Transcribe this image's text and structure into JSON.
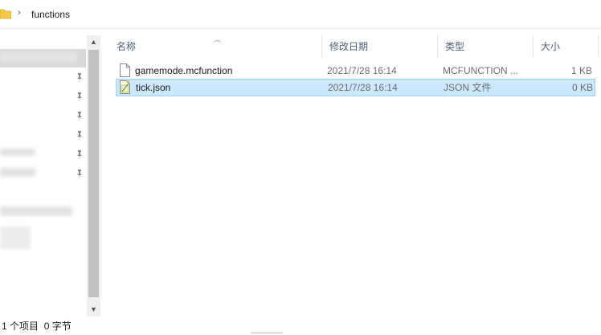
{
  "address_bar": {
    "folder_icon": "folder-icon",
    "separator": "›",
    "crumbs": [
      "functions"
    ]
  },
  "columns": {
    "name": "名称",
    "date": "修改日期",
    "type": "类型",
    "size": "大小"
  },
  "files": [
    {
      "name": "gamemode.mcfunction",
      "date": "2021/7/28 16:14",
      "type": "MCFUNCTION ...",
      "size": "1 KB",
      "icon": "blank-file-icon",
      "selected": false
    },
    {
      "name": "tick.json",
      "date": "2021/7/28 16:14",
      "type": "JSON 文件",
      "size": "0 KB",
      "icon": "json-file-icon",
      "selected": true
    }
  ],
  "status": {
    "item_count": "1 个项目",
    "selection": "0 字节"
  },
  "colors": {
    "selection_bg": "#cce8ff",
    "selection_border": "#99d1ff",
    "header_text": "#4c607a",
    "folder": "#f7c948"
  }
}
